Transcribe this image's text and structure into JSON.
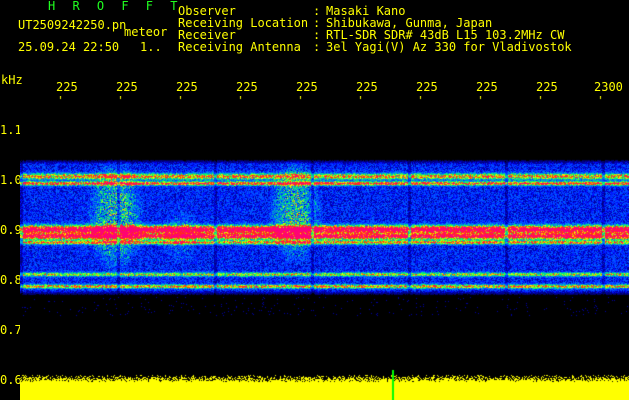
{
  "header": {
    "logo": "H R O F F T",
    "filename": "UT2509242250.pn",
    "mode": "meteor",
    "datetime": "25.09.24 22:50",
    "counter": "1.."
  },
  "station": {
    "labels": [
      "Observer",
      "Receiving Location",
      "Receiver",
      "Receiving Antenna"
    ],
    "separator": ":",
    "values": [
      "Masaki Kano",
      "Shibukawa, Gunma, Japan",
      "RTL-SDR SDR# 43dB L15 103.2MHz CW",
      "3el Yagi(V) Az 330 for Vladivostok"
    ]
  },
  "axis": {
    "y_unit": "kHz",
    "y_ticks": [
      "1.1",
      "1.0",
      "0.9",
      "0.8",
      "0.7",
      "0.6"
    ],
    "x_ticks": [
      "225",
      "225",
      "225",
      "225",
      "225",
      "225",
      "225",
      "225",
      "225",
      "2300"
    ]
  },
  "colors": {
    "foreground": "#ffff00",
    "logo": "#20ff20",
    "background": "#000000",
    "marker": "#00ff00"
  }
}
